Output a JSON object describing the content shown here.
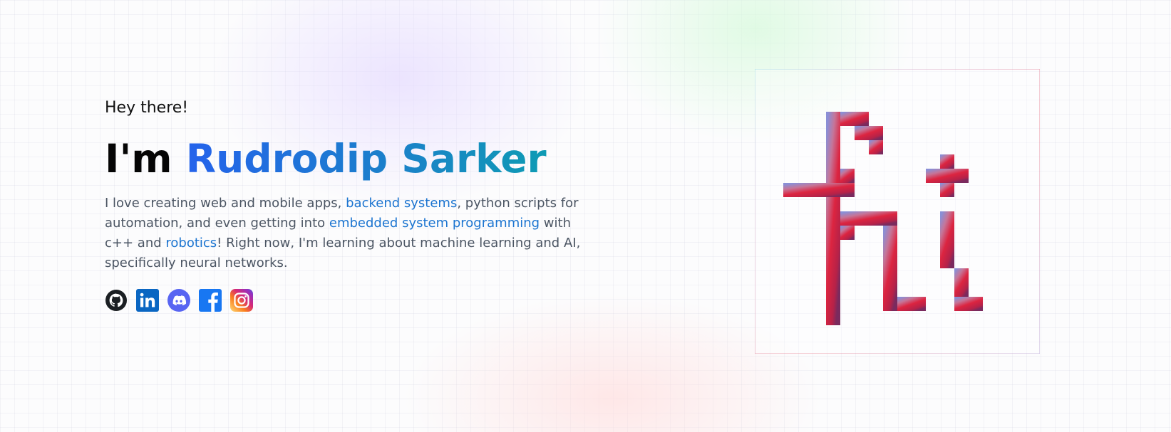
{
  "hero": {
    "greeting": "Hey there!",
    "headline_prefix": "I'm ",
    "name": "Rudrodip Sarker",
    "bio": {
      "t1": "I love creating web and mobile apps, ",
      "link1": "backend systems",
      "t2": ", python scripts for automation, and even getting into ",
      "link2": "embedded system programming",
      "t3": " with c++ and ",
      "link3": "robotics",
      "t4": "! Right now, I'm learning about machine learning and AI, specifically neural networks."
    }
  },
  "socials": [
    {
      "name": "GitHub",
      "icon": "github-icon"
    },
    {
      "name": "LinkedIn",
      "icon": "linkedin-icon"
    },
    {
      "name": "Discord",
      "icon": "discord-icon"
    },
    {
      "name": "Facebook",
      "icon": "facebook-icon"
    },
    {
      "name": "Instagram",
      "icon": "instagram-icon"
    }
  ],
  "logo": {
    "icon": "pixel-logo-icon"
  },
  "colors": {
    "name_gradient_start": "#2563eb",
    "name_gradient_end": "#0e9bb4",
    "link": "#1b74d0",
    "body_text": "#4b5563",
    "logo_gradient_start": "#8a8fd6",
    "logo_gradient_mid": "#dc2440",
    "logo_gradient_end": "#7a2a5e"
  }
}
